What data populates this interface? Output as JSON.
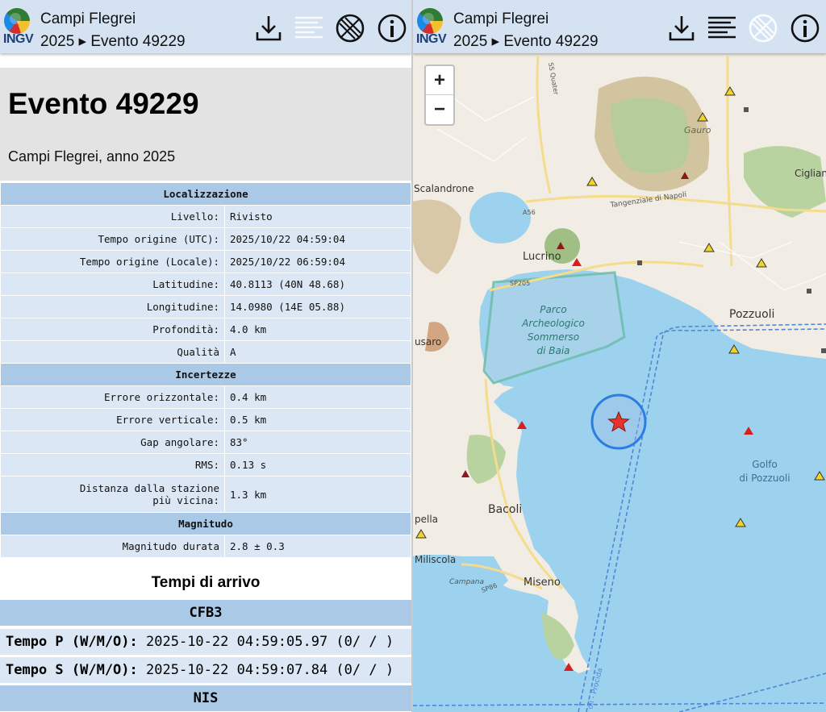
{
  "app": {
    "logo_text": "INGV",
    "title": "Campi Flegrei",
    "subtitle": "2025 ▸ Evento 49229"
  },
  "toolbar_icons": [
    "download-icon",
    "list-icon",
    "no-filter-icon",
    "info-icon"
  ],
  "event": {
    "heading": "Evento 49229",
    "description": "Campi Flegrei, anno 2025"
  },
  "sections": {
    "localizzazione": "Localizzazione",
    "incertezze": "Incertezze",
    "magnitudo": "Magnitudo"
  },
  "rows": {
    "livello": {
      "k": "Livello:",
      "v": "Rivisto"
    },
    "utc": {
      "k": "Tempo origine (UTC):",
      "v": "2025/10/22 04:59:04"
    },
    "locale": {
      "k": "Tempo origine (Locale):",
      "v": "2025/10/22 06:59:04"
    },
    "lat": {
      "k": "Latitudine:",
      "v": "40.8113 (40N 48.68)"
    },
    "lon": {
      "k": "Longitudine:",
      "v": "14.0980 (14E 05.88)"
    },
    "prof": {
      "k": "Profondità:",
      "v": "4.0 km"
    },
    "qual": {
      "k": "Qualità",
      "v": "A"
    },
    "err_orizz": {
      "k": "Errore orizzontale:",
      "v": "0.4 km"
    },
    "err_vert": {
      "k": "Errore verticale:",
      "v": "0.5 km"
    },
    "gap": {
      "k": "Gap angolare:",
      "v": "83°"
    },
    "rms": {
      "k": "RMS:",
      "v": "0.13 s"
    },
    "dist_a": "Distanza dalla stazione",
    "dist_b": "più vicina:",
    "dist_v": "1.3 km",
    "mag": {
      "k": "Magnitudo durata",
      "v": "2.8 ± 0.3"
    }
  },
  "arrivals": {
    "title": "Tempi di arrivo",
    "stations": [
      {
        "name": "CFB3",
        "p_label": "Tempo P (W/M/O):",
        "p_value": "2025-10-22 04:59:05.97 (0/ / )",
        "s_label": "Tempo S (W/M/O):",
        "s_value": "2025-10-22 04:59:07.84 (0/ / )"
      },
      {
        "name": "NIS"
      }
    ]
  },
  "map": {
    "zoom_in": "+",
    "zoom_out": "−",
    "places": {
      "scalandrone": "Scalandrone",
      "lucrino": "Lucrino",
      "pozzuoli": "Pozzuoli",
      "bacoli": "Bacoli",
      "miseno": "Miseno",
      "miliscola": "Miliscola",
      "gauro": "Gauro",
      "cigliano": "Cigliano",
      "pella": "pella",
      "usaro": "usaro",
      "parco_1": "Parco",
      "parco_2": "Archeologico",
      "parco_3": "Sommerso",
      "parco_4": "di Baia",
      "golfo_1": "Golfo",
      "golfo_2": "di Pozzuoli",
      "road_tang": "Tangenziale di Napoli",
      "road_a56": "A56",
      "road_sp205": "SP205",
      "road_sp86": "SP86",
      "road_ss": "SS Quater",
      "road_campana": "Campana",
      "ferry": "oli - Procida",
      "campana_via": "Campana"
    },
    "colors": {
      "sea": "#9dd2ef",
      "land": "#f1ede4",
      "green": "#c8dfb0",
      "event_star": "#e8332a",
      "event_circle": "#2b7de0",
      "station_up": "#f2d32b",
      "station_red": "#d81f1f"
    }
  }
}
